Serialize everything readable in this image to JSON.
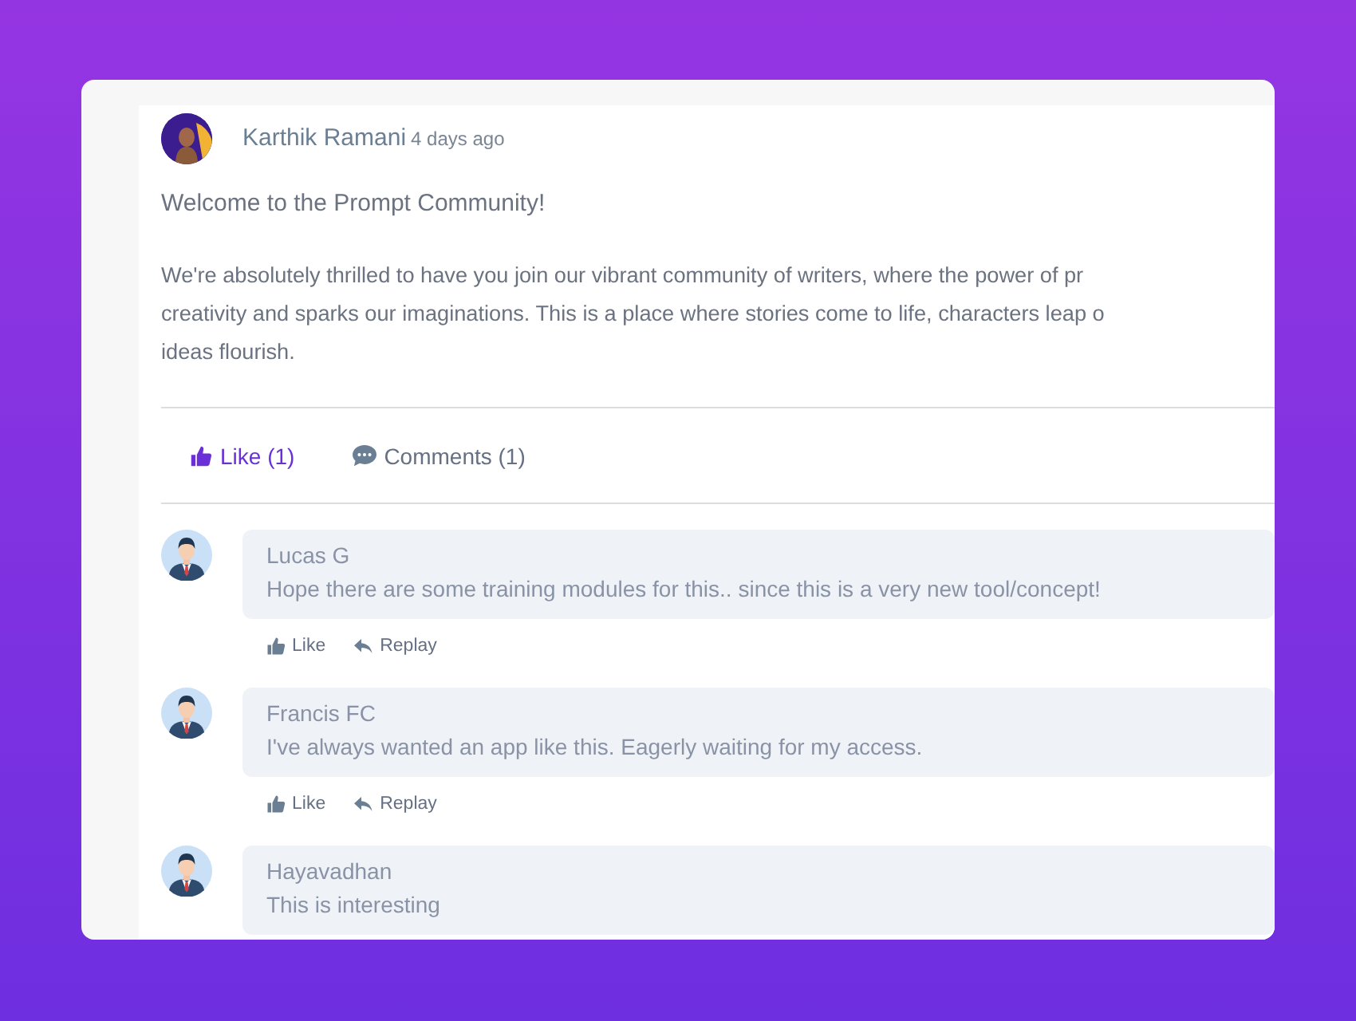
{
  "post": {
    "author": "Karthik Ramani",
    "time": "4 days ago",
    "title": "Welcome to the Prompt Community!",
    "body_lines": [
      "We're absolutely thrilled to have you join our vibrant community of writers, where the power of pr",
      "creativity and sparks our imaginations. This is a place where stories come to life, characters leap o",
      "ideas flourish."
    ],
    "like": {
      "label": "Like (1)",
      "selected": true
    },
    "comments_button": {
      "label": "Comments (1)"
    }
  },
  "comments": [
    {
      "author": "Lucas G",
      "text": "Hope there are some training modules for this.. since this is a very new tool/concept!",
      "like": "Like",
      "reply": "Replay"
    },
    {
      "author": "Francis FC",
      "text": "I've always wanted an app like this. Eagerly waiting for my access.",
      "like": "Like",
      "reply": "Replay"
    },
    {
      "author": "Hayavadhan",
      "text": "This is interesting"
    }
  ]
}
